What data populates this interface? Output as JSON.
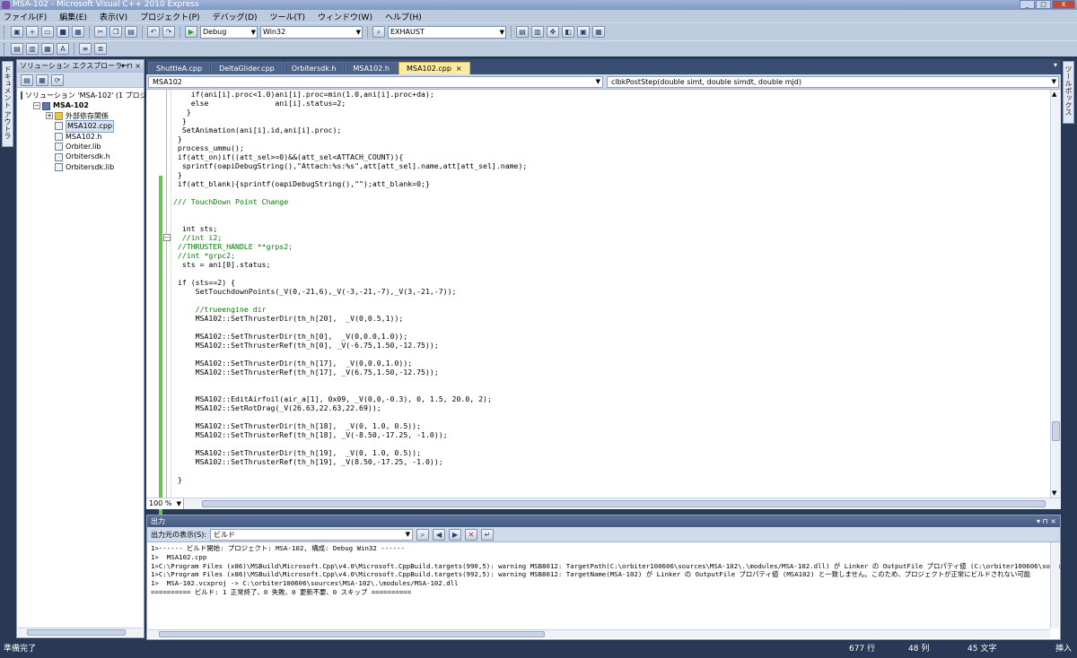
{
  "window": {
    "title": "MSA-102 - Microsoft Visual C++ 2010 Express",
    "min": "_",
    "max": "□",
    "close": "X"
  },
  "menu": [
    "ファイル(F)",
    "編集(E)",
    "表示(V)",
    "プロジェクト(P)",
    "デバッグ(D)",
    "ツール(T)",
    "ウィンドウ(W)",
    "ヘルプ(H)"
  ],
  "toolbar": {
    "config": "Debug",
    "platform": "Win32",
    "find": "EXHAUST"
  },
  "left_strip": {
    "label": "ドキュメント アウトライン"
  },
  "right_strip": {
    "label": "ツールボックス"
  },
  "solution_explorer": {
    "title": "ソリューション エクスプローラー",
    "header_icons": "▾ ⊓ ×",
    "items": [
      {
        "label": "ソリューション 'MSA-102' (1 プロジ",
        "type": "solution",
        "indent": 0,
        "expander": ""
      },
      {
        "label": "MSA-102",
        "type": "project",
        "indent": 1,
        "expander": "−"
      },
      {
        "label": "外部依存関係",
        "type": "folder",
        "indent": 2,
        "expander": "+"
      },
      {
        "label": "MSA102.cpp",
        "type": "cpp",
        "indent": 2,
        "expander": "",
        "selected": true
      },
      {
        "label": "MSA102.h",
        "type": "h",
        "indent": 2,
        "expander": ""
      },
      {
        "label": "Orbiter.lib",
        "type": "lib",
        "indent": 2,
        "expander": ""
      },
      {
        "label": "Orbitersdk.h",
        "type": "h",
        "indent": 2,
        "expander": ""
      },
      {
        "label": "Orbitersdk.lib",
        "type": "lib",
        "indent": 2,
        "expander": ""
      }
    ]
  },
  "tabs": [
    {
      "label": "ShuttleA.cpp",
      "active": false
    },
    {
      "label": "DeltaGlider.cpp",
      "active": false
    },
    {
      "label": "Orbitersdk.h",
      "active": false
    },
    {
      "label": "MSA102.h",
      "active": false
    },
    {
      "label": "MSA102.cpp",
      "active": true
    }
  ],
  "tab_close": "×",
  "tab_menu": "▾",
  "nav": {
    "scope": "MSA102",
    "member": "clbkPostStep(double simt, double simdt, double mjd)"
  },
  "code_lines": [
    {
      "text": "    if(ani[i].proc<1.0)ani[i].proc=min(1.0,ani[i].proc+da);",
      "type": "code"
    },
    {
      "text": "    else               ani[i].status=2;",
      "type": "code"
    },
    {
      "text": "   }",
      "type": "code"
    },
    {
      "text": "  }",
      "type": "code"
    },
    {
      "text": "  SetAnimation(ani[i].id,ani[i].proc);",
      "type": "code"
    },
    {
      "text": " }",
      "type": "code"
    },
    {
      "text": " process_ummu();",
      "type": "code"
    },
    {
      "text": " if(att_on)if((att_sel>=0)&&(att_sel<ATTACH_COUNT)){",
      "type": "code"
    },
    {
      "text": "  sprintf(oapiDebugString(),\"Attach:%s:%s\",att[att_sel].name,att[att_sel].name);",
      "type": "code"
    },
    {
      "text": " }",
      "type": "code"
    },
    {
      "text": " if(att_blank){sprintf(oapiDebugString(),\"\");att_blank=0;}",
      "type": "code"
    },
    {
      "text": "",
      "type": "code"
    },
    {
      "text": "/// TouchDown Point Change",
      "type": "comment"
    },
    {
      "text": "",
      "type": "code"
    },
    {
      "text": "",
      "type": "code"
    },
    {
      "text": "  int sts;",
      "type": "code"
    },
    {
      "text": "  //int i2;",
      "type": "comment"
    },
    {
      "text": " //THRUSTER_HANDLE **grps2;",
      "type": "comment"
    },
    {
      "text": " //int *grpc2;",
      "type": "comment"
    },
    {
      "text": "  sts = ani[0].status;",
      "type": "code"
    },
    {
      "text": "",
      "type": "code"
    },
    {
      "text": " if (sts==2) {",
      "type": "code"
    },
    {
      "text": "     SetTouchdownPoints(_V(0,-21,6),_V(-3,-21,-7),_V(3,-21,-7));",
      "type": "code"
    },
    {
      "text": "",
      "type": "code"
    },
    {
      "text": "     //trueengine dir",
      "type": "comment"
    },
    {
      "text": "     MSA102::SetThrusterDir(th_h[20],  _V(0,0.5,1));",
      "type": "code"
    },
    {
      "text": "",
      "type": "code"
    },
    {
      "text": "     MSA102::SetThrusterDir(th_h[0],  _V(0,0.0,1.0));",
      "type": "code"
    },
    {
      "text": "     MSA102::SetThrusterRef(th_h[0], _V(-6.75,1.50,-12.75));",
      "type": "code"
    },
    {
      "text": "",
      "type": "code"
    },
    {
      "text": "     MSA102::SetThrusterDir(th_h[17],  _V(0,0.0,1.0));",
      "type": "code"
    },
    {
      "text": "     MSA102::SetThrusterRef(th_h[17], _V(6.75,1.50,-12.75));",
      "type": "code"
    },
    {
      "text": "",
      "type": "code"
    },
    {
      "text": "",
      "type": "code"
    },
    {
      "text": "     MSA102::EditAirfoil(air_a[1], 0x09, _V(0,0,-0.3), 0, 1.5, 20.0, 2);",
      "type": "code"
    },
    {
      "text": "     MSA102::SetRotDrag(_V(26.63,22.63,22.69));",
      "type": "code"
    },
    {
      "text": "",
      "type": "code"
    },
    {
      "text": "     MSA102::SetThrusterDir(th_h[18],  _V(0, 1.0, 0.5));",
      "type": "code"
    },
    {
      "text": "     MSA102::SetThrusterRef(th_h[18], _V(-8.50,-17.25, -1.0));",
      "type": "code"
    },
    {
      "text": "",
      "type": "code"
    },
    {
      "text": "     MSA102::SetThrusterDir(th_h[19],  _V(0, 1.0, 0.5));",
      "type": "code"
    },
    {
      "text": "     MSA102::SetThrusterRef(th_h[19], _V(8.50,-17.25, -1.0));",
      "type": "code"
    },
    {
      "text": "",
      "type": "code"
    },
    {
      "text": " }",
      "type": "code"
    }
  ],
  "zoom": "100 %",
  "output": {
    "title": "出力",
    "header_icons": "▾ ⊓ ×",
    "source_label": "出力元の表示(S):",
    "source_value": "ビルド",
    "lines": [
      "1>------ ビルド開始: プロジェクト: MSA-102, 構成: Debug Win32 ------",
      "1>  MSA102.cpp",
      "1>C:\\Program Files (x86)\\MSBuild\\Microsoft.Cpp\\v4.0\\Microsoft.CppBuild.targets(990,5): warning MSB8012: TargetPath(C:\\orbiter100606\\sources\\MSA-102\\.\\modules/MSA-102.dll) が Linker の OutputFile プロパティ値 (C:\\orbiter100606\\sources",
      "1>C:\\Program Files (x86)\\MSBuild\\Microsoft.Cpp\\v4.0\\Microsoft.CppBuild.targets(992,5): warning MSB8012: TargetName(MSA-102) が Linker の OutputFile プロパティ値 (MSA102) と一致しません。このため、プロジェクトが正常にビルドされない可能",
      "1>  MSA-102.vcxproj -> C:\\orbiter100606\\sources\\MSA-102\\.\\modules/MSA-102.dll",
      "========== ビルド: 1 正常終了、0 失敗、0 更新不要、0 スキップ =========="
    ]
  },
  "status": {
    "ready": "準備完了",
    "line": "677 行",
    "col": "48 列",
    "char": "45 文字",
    "mode": "挿入"
  }
}
